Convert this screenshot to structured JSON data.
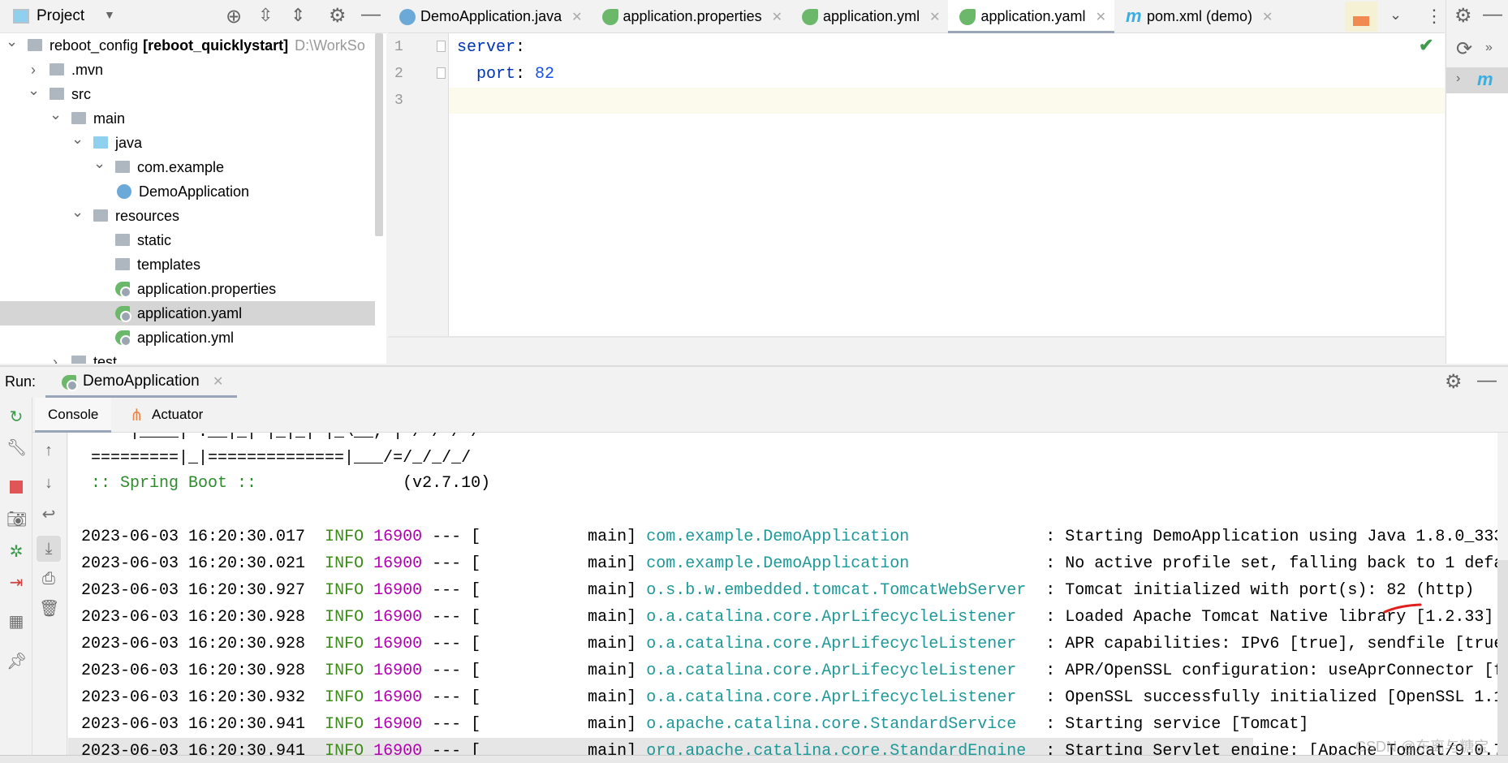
{
  "project_panel": {
    "title": "Project",
    "icons": [
      "locate-icon",
      "expand-all-icon",
      "collapse-all-icon",
      "gear-icon",
      "minimize-icon"
    ]
  },
  "tree": [
    {
      "label": "reboot_config",
      "bold": "[reboot_quicklystart]",
      "path": "D:\\WorkSo",
      "level": 0,
      "state": "expanded",
      "icon": "module"
    },
    {
      "label": ".mvn",
      "level": 1,
      "state": "collapsed",
      "icon": "folder"
    },
    {
      "label": "src",
      "level": 1,
      "state": "expanded",
      "icon": "folder"
    },
    {
      "label": "main",
      "level": 2,
      "state": "expanded",
      "icon": "folder"
    },
    {
      "label": "java",
      "level": 3,
      "state": "expanded",
      "icon": "source-folder"
    },
    {
      "label": "com.example",
      "level": 4,
      "state": "expanded",
      "icon": "package"
    },
    {
      "label": "DemoApplication",
      "level": 5,
      "state": "leaf",
      "icon": "spring-class"
    },
    {
      "label": "resources",
      "level": 3,
      "state": "expanded",
      "icon": "resources-folder"
    },
    {
      "label": "static",
      "level": 4,
      "state": "leaf",
      "icon": "folder"
    },
    {
      "label": "templates",
      "level": 4,
      "state": "leaf",
      "icon": "folder"
    },
    {
      "label": "application.properties",
      "level": 4,
      "state": "leaf",
      "icon": "spring-config"
    },
    {
      "label": "application.yaml",
      "level": 4,
      "state": "leaf",
      "icon": "spring-config",
      "selected": true
    },
    {
      "label": "application.yml",
      "level": 4,
      "state": "leaf",
      "icon": "spring-config"
    },
    {
      "label": "test",
      "level": 2,
      "state": "collapsed",
      "icon": "folder"
    }
  ],
  "tabs": [
    {
      "label": "DemoApplication.java",
      "icon": "spring-class"
    },
    {
      "label": "application.properties",
      "icon": "spring-config"
    },
    {
      "label": "application.yml",
      "icon": "spring-config"
    },
    {
      "label": "application.yaml",
      "icon": "spring-config",
      "active": true
    },
    {
      "label": "pom.xml (demo)",
      "icon": "maven"
    }
  ],
  "editor": {
    "lines": [
      {
        "n": "1",
        "key": "server",
        "sep": ":",
        "val": ""
      },
      {
        "n": "2",
        "key": "  port",
        "sep": ": ",
        "val": "82"
      },
      {
        "n": "3",
        "key": "",
        "sep": "",
        "val": ""
      }
    ],
    "status": "check-icon"
  },
  "run": {
    "label": "Run:",
    "config": "DemoApplication",
    "tabs": [
      "Console",
      "Actuator"
    ]
  },
  "console": {
    "banner": [
      "  '  |____| .__|_| |_|_| |_\\__, | / / / /",
      " =========|_|==============|___/=/_/_/_/"
    ],
    "spring_label": " :: Spring Boot :: ",
    "spring_version": "              (v2.7.10)",
    "logs": [
      {
        "time": "2023-06-03 16:20:30.017",
        "level": "INFO",
        "pid": "16900",
        "thread": "main",
        "logger": "com.example.DemoApplication",
        "message": "Starting DemoApplication using Java 1.8.0_333"
      },
      {
        "time": "2023-06-03 16:20:30.021",
        "level": "INFO",
        "pid": "16900",
        "thread": "main",
        "logger": "com.example.DemoApplication",
        "message": "No active profile set, falling back to 1 defa"
      },
      {
        "time": "2023-06-03 16:20:30.927",
        "level": "INFO",
        "pid": "16900",
        "thread": "main",
        "logger": "o.s.b.w.embedded.tomcat.TomcatWebServer",
        "message": "Tomcat initialized with port(s): 82 (http)"
      },
      {
        "time": "2023-06-03 16:20:30.928",
        "level": "INFO",
        "pid": "16900",
        "thread": "main",
        "logger": "o.a.catalina.core.AprLifecycleListener",
        "message": "Loaded Apache Tomcat Native library [1.2.33]"
      },
      {
        "time": "2023-06-03 16:20:30.928",
        "level": "INFO",
        "pid": "16900",
        "thread": "main",
        "logger": "o.a.catalina.core.AprLifecycleListener",
        "message": "APR capabilities: IPv6 [true], sendfile [true"
      },
      {
        "time": "2023-06-03 16:20:30.928",
        "level": "INFO",
        "pid": "16900",
        "thread": "main",
        "logger": "o.a.catalina.core.AprLifecycleListener",
        "message": "APR/OpenSSL configuration: useAprConnector [f"
      },
      {
        "time": "2023-06-03 16:20:30.932",
        "level": "INFO",
        "pid": "16900",
        "thread": "main",
        "logger": "o.a.catalina.core.AprLifecycleListener",
        "message": "OpenSSL successfully initialized [OpenSSL 1.1"
      },
      {
        "time": "2023-06-03 16:20:30.941",
        "level": "INFO",
        "pid": "16900",
        "thread": "main",
        "logger": "o.apache.catalina.core.StandardService",
        "message": "Starting service [Tomcat]"
      },
      {
        "time": "2023-06-03 16:20:30.941",
        "level": "INFO",
        "pid": "16900",
        "thread": "main",
        "logger": "org.apache.catalina.core.StandardEngine",
        "message": "Starting Servlet engine: [Apache Tomcat/9.0.7"
      }
    ]
  },
  "watermark": "CSDN @东离与糖宝",
  "colors": {
    "info": "#3c8c1a",
    "pid": "#b200b2",
    "logger": "#1f9898",
    "yaml_key": "#0033b3",
    "yaml_number": "#1750eb",
    "annotation": "#e0201c"
  }
}
